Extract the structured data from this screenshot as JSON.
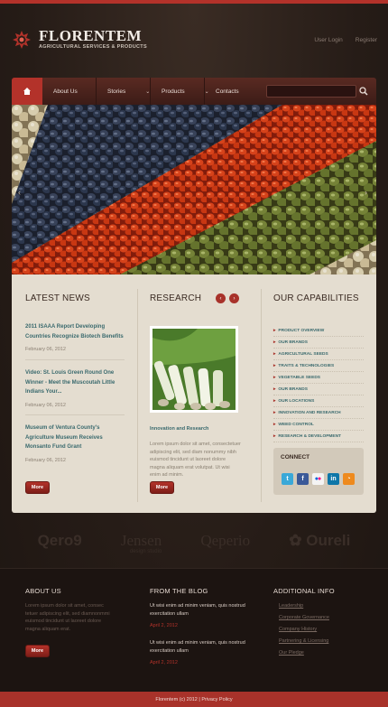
{
  "header": {
    "logo_title": "FLORENTEM",
    "logo_subtitle": "AGRICULTURAL SERVICES & PRODUCTS",
    "user_login": "User Login",
    "register": "Register"
  },
  "nav": {
    "items": [
      {
        "label": "About Us"
      },
      {
        "label": "Stories"
      },
      {
        "label": "Products"
      },
      {
        "label": "Contacts"
      }
    ],
    "search_placeholder": ""
  },
  "latest_news": {
    "title": "LATEST NEWS",
    "items": [
      {
        "title": "2011 ISAAA Report Developing Countries Recognize Biotech Benefits",
        "date": "February 06, 2012"
      },
      {
        "title": "Video: St. Louis Green Round One Winner - Meet the Muscoutah Little Indians Your...",
        "date": "February 06, 2012"
      },
      {
        "title": "Museum of Ventura County's Agriculture Museum Receives Monsanto Fund Grant",
        "date": "February 06, 2012"
      }
    ],
    "more_label": "More"
  },
  "research": {
    "title": "RESEARCH",
    "link": "Innovation and Research",
    "text": "Lorem ipsum dolor sit amet, consectetuer adipiscing elit, sed diam nonummy nibh euismod tincidunt ut laoreet dolore magna aliquam erat volutpat. Ut wisi enim ad minim.",
    "more_label": "More"
  },
  "capabilities": {
    "title": "OUR CAPABILITIES",
    "items": [
      "PRODUCT OVERVIEW",
      "OUR BRANDS",
      "AGRICULTURAL SEEDS",
      "TRAITS & TECHNOLOGIES",
      "VEGETABLE SEEDS",
      "OUR BRANDS",
      "OUR LOCATIONS",
      "INNOVATION AND RESEARCH",
      "WEED CONTROL",
      "RESEARCH & DEVELOPMENT"
    ],
    "connect_title": "CONNECT",
    "social": [
      "twitter-icon",
      "facebook-icon",
      "flickr-icon",
      "linkedin-icon",
      "rss-icon"
    ]
  },
  "partners": [
    "Qero9",
    "Jensen",
    "Qeperio",
    "Oureli"
  ],
  "partner_jensen_sub": "design studio",
  "footer": {
    "about_title": "ABOUT US",
    "about_text": "Lorem ipsum dolor sit amet, consec tetuer adipiscing elit, sed diamnonmmi euismod tincidunt ut laoreet dolore magna aliquam erat.",
    "about_more": "More",
    "blog_title": "FROM THE BLOG",
    "blog": [
      {
        "text": "Ut wisi enim ad minim veniam, quis nostrud exercitation ullam",
        "date": "April 2, 2012"
      },
      {
        "text": "Ut wisi enim ad minim veniam, quis nostrud exercitation ullam",
        "date": "April 2, 2012"
      }
    ],
    "info_title": "ADDITIONAL INFO",
    "links": [
      "Leadership",
      "Corporate Governance",
      "Company History",
      "Partnering & Licensing",
      "Our Pledge"
    ]
  },
  "copyright": "Florentem  (c) 2012  |  Privacy Policy",
  "colors": {
    "accent": "#b3322a",
    "panel": "#e4ddd0",
    "link": "#3a6a6e"
  }
}
